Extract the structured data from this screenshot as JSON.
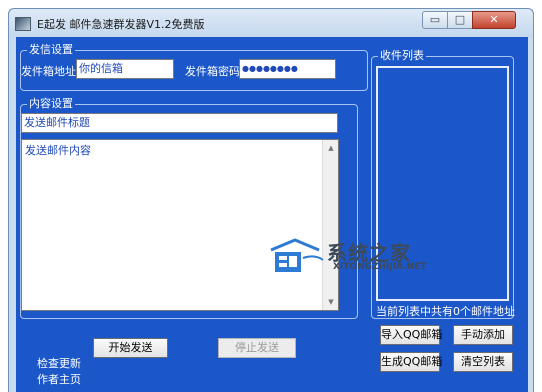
{
  "window": {
    "title": "E起发 邮件急速群发器V1.2免费版",
    "min_glyph": "▭",
    "max_glyph": "□",
    "close_glyph": "✕"
  },
  "sender": {
    "group_title": "发信设置",
    "email_label": "发件箱地址",
    "email_value": "你的信箱",
    "password_label": "发件箱密码",
    "password_value": "●●●●●●●●"
  },
  "content": {
    "group_title": "内容设置",
    "subject_value": "发送邮件标题",
    "body_value": "发送邮件内容"
  },
  "recipients": {
    "group_title": "收件列表",
    "count_text": "当前列表中共有0个邮件地址"
  },
  "actions": {
    "start_send": "开始发送",
    "stop_send": "停止发送",
    "import_qq": "导入QQ邮箱",
    "manual_add": "手动添加",
    "generate_qq": "生成QQ邮箱",
    "clear_list": "清空列表"
  },
  "links": {
    "check_update": "检查更新",
    "author_home": "作者主页"
  },
  "watermark": {
    "cn": "系统之家",
    "en": "XITONGZHIJIA.NET"
  },
  "colors": {
    "client_bg": "#1b57c9",
    "field_text": "#1f49b8"
  }
}
